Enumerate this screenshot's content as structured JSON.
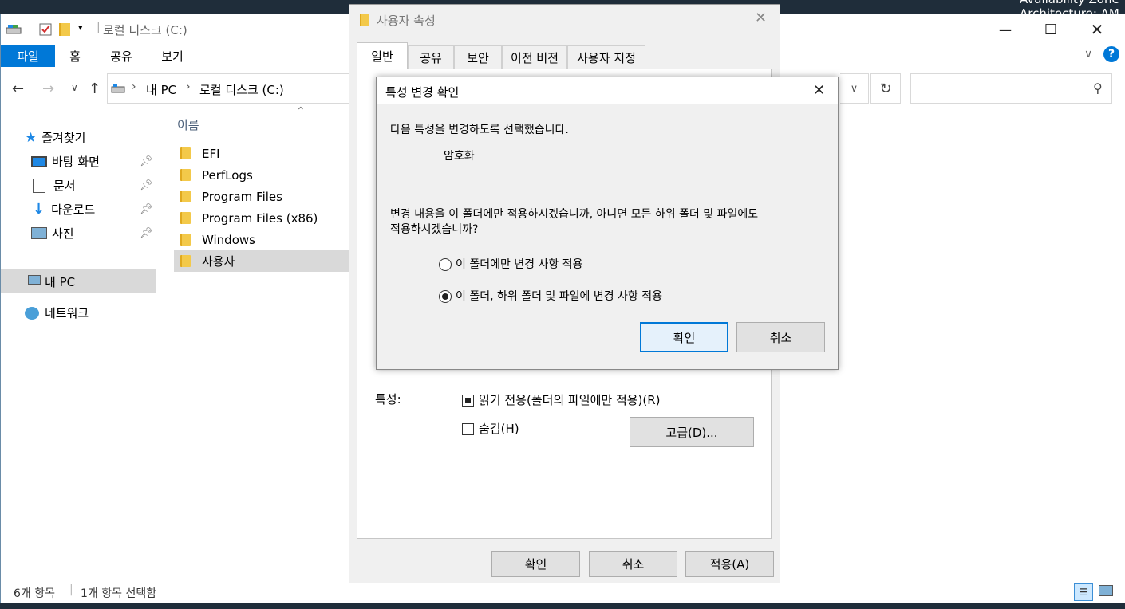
{
  "desktop": {
    "text1": "Availability Zone",
    "text2": "Architecture: AM"
  },
  "explorer": {
    "title": "로컬 디스크 (C:)",
    "controls": {
      "minimize": "—",
      "maximize": "☐",
      "close": "✕"
    },
    "ribbon_tabs": [
      "파일",
      "홈",
      "공유",
      "보기"
    ],
    "help_icon": "?",
    "address": {
      "part1": "내 PC",
      "part2": "로컬 디스크 (C:)",
      "separator": "›"
    },
    "search_placeholder": "",
    "column_header": "이름",
    "nav": {
      "favorites": "즐겨찾기",
      "items": [
        "바탕 화면",
        "문서",
        "다운로드",
        "사진"
      ],
      "this_pc": "내 PC",
      "network": "네트워크"
    },
    "files": [
      "EFI",
      "PerfLogs",
      "Program Files",
      "Program Files (x86)",
      "Windows",
      "사용자"
    ],
    "status": {
      "count": "6개 항목",
      "selected": "1개 항목 선택함"
    }
  },
  "props_dialog": {
    "title": "사용자 속성",
    "close": "✕",
    "tabs": [
      "일반",
      "공유",
      "보안",
      "이전 버전",
      "사용자 지정"
    ],
    "attributes_label": "특성:",
    "readonly_label": "읽기 전용(폴더의 파일에만 적용)(R)",
    "hidden_label": "숨김(H)",
    "advanced_button": "고급(D)...",
    "ok": "확인",
    "cancel": "취소",
    "apply": "적용(A)"
  },
  "confirm_dialog": {
    "title": "특성 변경 확인",
    "close": "✕",
    "intro": "다음 특성을 변경하도록 선택했습니다.",
    "attribute": "암호화",
    "question_line1": "변경 내용을 이 폴더에만 적용하시겠습니까, 아니면 모든 하위 폴더 및 파일에도",
    "question_line2": "적용하시겠습니까?",
    "option1": "이 폴더에만 변경 사항 적용",
    "option2": "이 폴더, 하위 폴더 및 파일에 변경 사항 적용",
    "selected_option": 2,
    "ok": "확인",
    "cancel": "취소"
  },
  "colors": {
    "accent": "#0078d7",
    "selection": "#cce8ff",
    "nav_selected": "#d9d9d9"
  }
}
